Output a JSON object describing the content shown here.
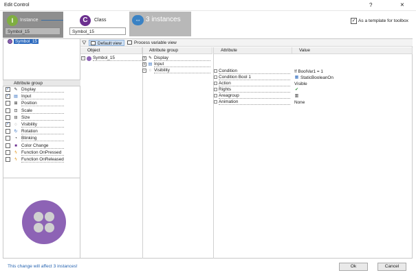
{
  "window": {
    "title": "Edit Control",
    "help_label": "?",
    "close_label": "×"
  },
  "steps": {
    "instance": {
      "letter": "I",
      "label": "Instance",
      "value": "Symbol_15"
    },
    "class": {
      "letter": "C",
      "label": "Class",
      "value": "Symbol_15"
    },
    "count": {
      "label": "3 instances"
    }
  },
  "template": {
    "label": "As a template for toolbox",
    "checked": true
  },
  "tree": {
    "selected": "Symbol_15"
  },
  "attribute_groups": {
    "header": "Attribute group",
    "items": [
      {
        "label": "Display",
        "checked": true,
        "icon": "display-icon"
      },
      {
        "label": "Input",
        "checked": true,
        "icon": "input-icon"
      },
      {
        "label": "Position",
        "checked": false,
        "icon": "position-icon"
      },
      {
        "label": "Scale",
        "checked": false,
        "icon": "scale-icon"
      },
      {
        "label": "Size",
        "checked": false,
        "icon": "size-icon"
      },
      {
        "label": "Visibility",
        "checked": true,
        "icon": "visibility-icon"
      },
      {
        "label": "Rotation",
        "checked": false,
        "icon": "rotation-icon"
      },
      {
        "label": "Blinking",
        "checked": false,
        "icon": "blinking-icon"
      },
      {
        "label": "Color Change",
        "checked": false,
        "icon": "color-change-icon"
      },
      {
        "label": "Function OnPressed",
        "checked": false,
        "icon": "function-icon"
      },
      {
        "label": "Function OnReleased",
        "checked": false,
        "icon": "function-icon"
      }
    ]
  },
  "toolbar": {
    "default_view": "Default view",
    "process_view": "Process variable view"
  },
  "columns": {
    "object": "Object",
    "attribute_group": "Attribute group",
    "attribute": "Attribute",
    "value": "Value"
  },
  "object_row": {
    "label": "Symbol_15"
  },
  "group_rows": [
    {
      "label": "Display",
      "expander": "+"
    },
    {
      "label": "Input",
      "expander": "+"
    },
    {
      "label": "Visibility",
      "expander": "−"
    }
  ],
  "attributes": [
    {
      "label": "Condition",
      "value": "!f BoolVar1 = 1",
      "value_icon": ""
    },
    {
      "label": "Condition Bool 1",
      "value": "StaticBooleanOn",
      "value_icon": "variable-icon"
    },
    {
      "label": "Action",
      "value": "Visible",
      "value_icon": ""
    },
    {
      "label": "Rights",
      "value": "",
      "value_icon": "check-circle-icon"
    },
    {
      "label": "Areagroup",
      "value": "",
      "value_icon": "areagroup-icon"
    },
    {
      "label": "Animation",
      "value": "None",
      "value_icon": ""
    }
  ],
  "footer": {
    "note": "This change will affect 3 instances!",
    "ok_label": "Ok",
    "cancel_label": "Cancel"
  },
  "colors": {
    "accent_blue": "#2d6bbf",
    "class_purple": "#6b2f8f",
    "instance_green": "#7fae41",
    "symbol_purple": "#8d63b5"
  }
}
